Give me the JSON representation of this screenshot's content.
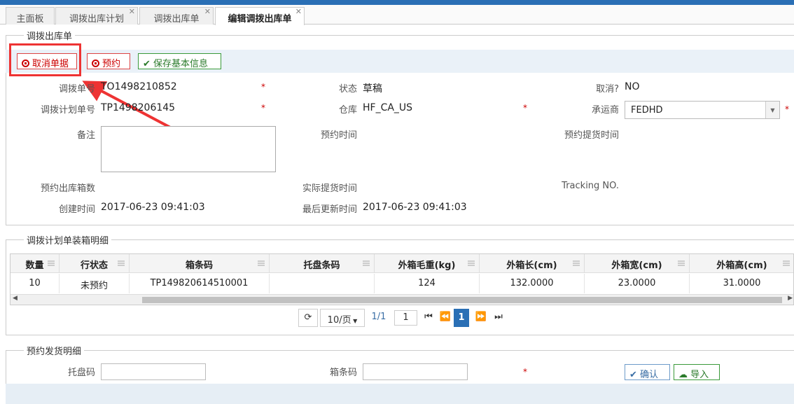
{
  "tabs": [
    {
      "label": "主面板",
      "closable": false
    },
    {
      "label": "调拨出库计划",
      "closable": true
    },
    {
      "label": "调拨出库单",
      "closable": true
    },
    {
      "label": "编辑调拨出库单",
      "closable": true,
      "active": true
    }
  ],
  "section1": {
    "title": "调拨出库单",
    "buttons": {
      "cancel": "取消单据",
      "reserve": "预约",
      "save": "保存基本信息"
    },
    "fields": {
      "transfer_no_label": "调拨单号",
      "transfer_no": "TO1498210852",
      "status_label": "状态",
      "status": "草稿",
      "cancelled_label": "取消?",
      "cancelled": "NO",
      "plan_no_label": "调拨计划单号",
      "plan_no": "TP1498206145",
      "warehouse_label": "仓库",
      "warehouse": "HF_CA_US",
      "carrier_label": "承运商",
      "carrier": "FEDHD",
      "remark_label": "备注",
      "reserve_time_label": "预约时间",
      "reserve_pickup_label": "预约提货时间",
      "reserve_boxes_label": "预约出库箱数",
      "actual_pickup_label": "实际提货时间",
      "tracking_label": "Tracking NO.",
      "created_label": "创建时间",
      "created": "2017-06-23 09:41:03",
      "updated_label": "最后更新时间",
      "updated": "2017-06-23 09:41:03"
    },
    "required_mark": "*"
  },
  "section2": {
    "title": "调拨计划单装箱明细",
    "columns": [
      "数量",
      "行状态",
      "箱条码",
      "托盘条码",
      "外箱毛重(kg)",
      "外箱长(cm)",
      "外箱宽(cm)",
      "外箱高(cm)"
    ],
    "rows": [
      [
        "10",
        "未预约",
        "TP149820614510001",
        "",
        "124",
        "132.0000",
        "23.0000",
        "31.0000"
      ]
    ],
    "pager": {
      "page_size": "10/页",
      "page_info": "1/1",
      "page_input": "1",
      "current_page": "1"
    }
  },
  "section3": {
    "title": "预约发货明细",
    "pallet_label": "托盘码",
    "box_label": "箱条码",
    "confirm": "确认",
    "import": "导入"
  },
  "colors": {
    "accent": "#2a6fb5",
    "danger": "#cc0000",
    "success": "#2a7a2a",
    "highlight": "#ee3333"
  }
}
